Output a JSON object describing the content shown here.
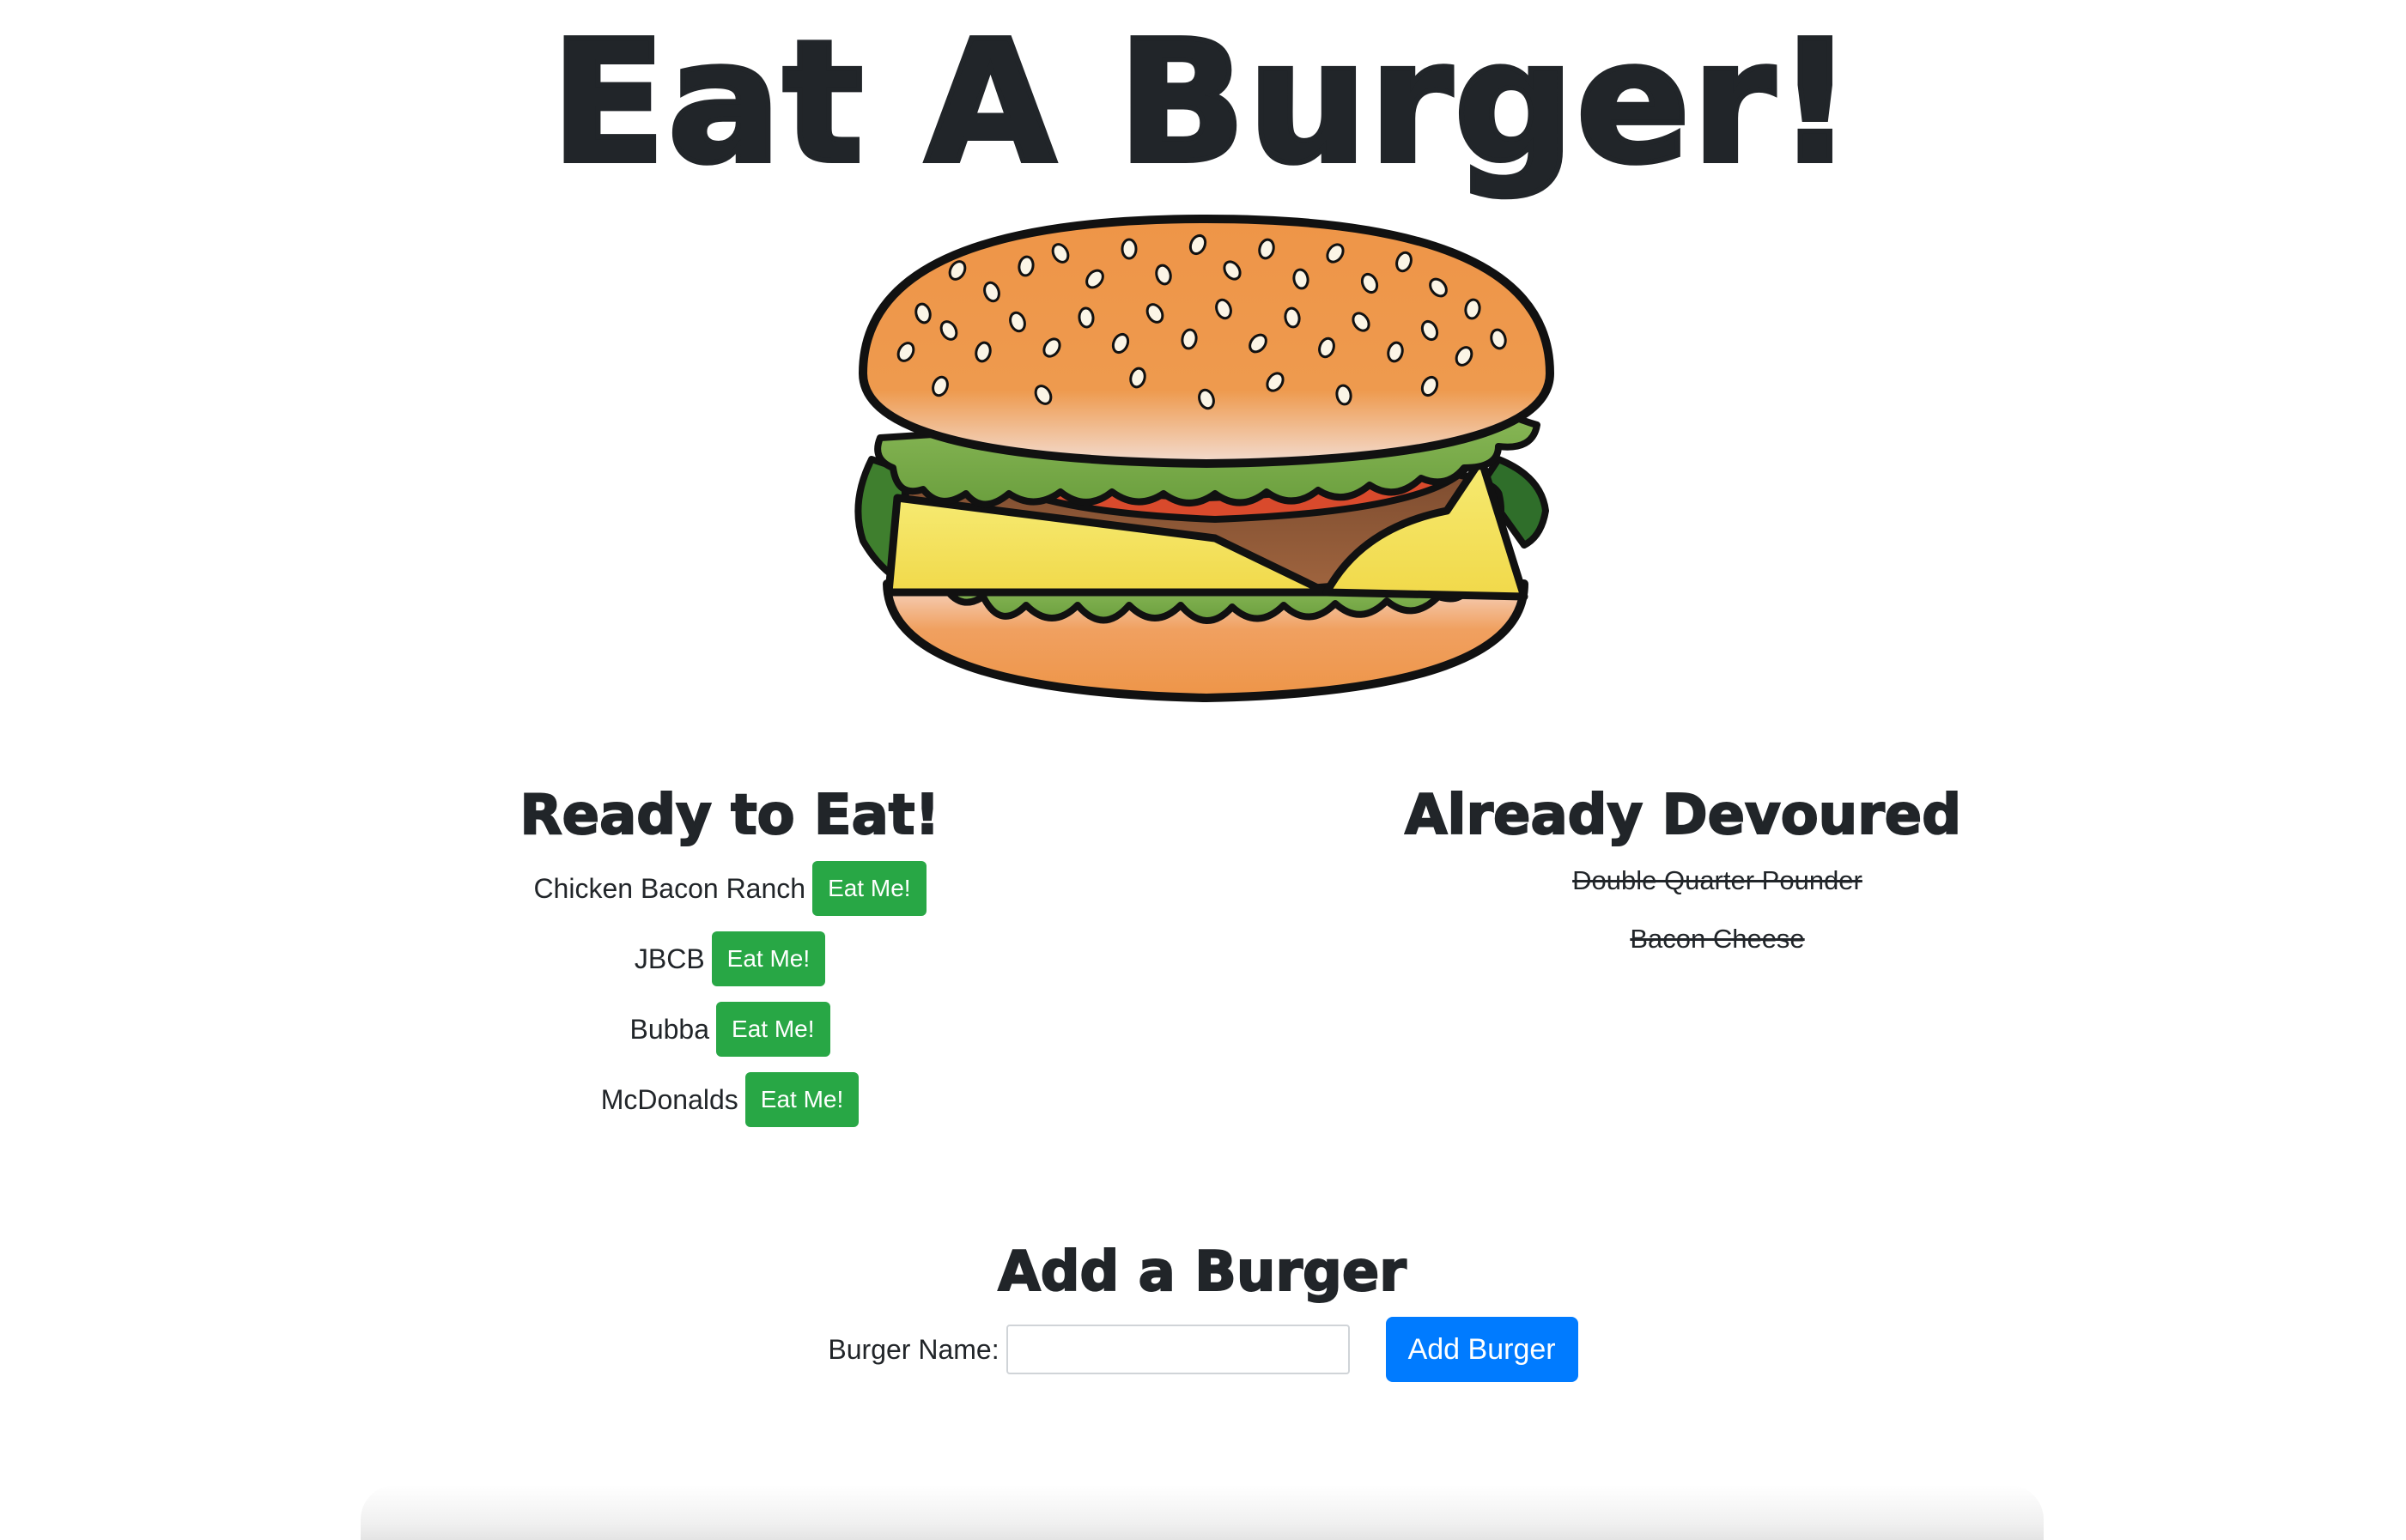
{
  "title": "Eat A Burger!",
  "ready": {
    "heading": "Ready to Eat!",
    "button_label": "Eat Me!",
    "items": [
      {
        "name": "Chicken Bacon Ranch"
      },
      {
        "name": "JBCB"
      },
      {
        "name": "Bubba"
      },
      {
        "name": "McDonalds"
      }
    ]
  },
  "devoured": {
    "heading": "Already Devoured",
    "items": [
      {
        "name": "Double Quarter Pounder"
      },
      {
        "name": "Bacon Cheese"
      }
    ]
  },
  "add_form": {
    "heading": "Add a Burger",
    "label": "Burger Name:",
    "input_value": "",
    "button_label": "Add Burger"
  },
  "colors": {
    "eat_button": "#28a745",
    "add_button": "#007bff",
    "text": "#212529"
  },
  "icons": {
    "hero_image": "burger-illustration"
  }
}
